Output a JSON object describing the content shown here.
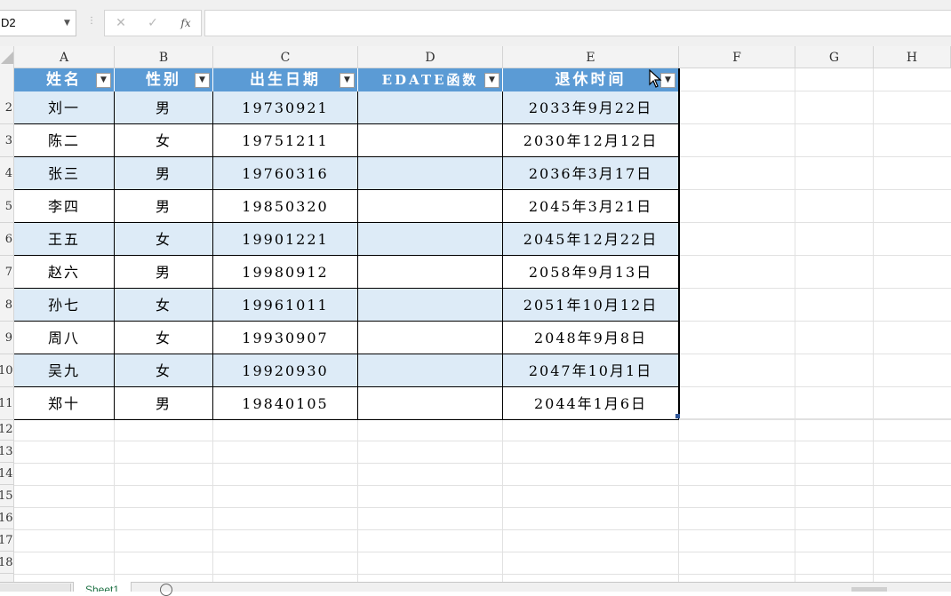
{
  "formula_bar": {
    "name_box": "D2",
    "cancel_icon": "✕",
    "confirm_icon": "✓",
    "fx_icon": "fx",
    "formula": ""
  },
  "columns": [
    "A",
    "B",
    "C",
    "D",
    "E",
    "F",
    "G",
    "H"
  ],
  "rows": [
    "2",
    "3",
    "4",
    "5",
    "6",
    "7",
    "8",
    "9",
    "10",
    "11",
    "12",
    "13",
    "14",
    "15",
    "16",
    "17",
    "18"
  ],
  "table": {
    "headers": [
      "姓名",
      "性别",
      "出生日期",
      "EDATE函数",
      "退休时间"
    ],
    "rows": [
      [
        "刘一",
        "男",
        "19730921",
        "",
        "2033年9月22日"
      ],
      [
        "陈二",
        "女",
        "19751211",
        "",
        "2030年12月12日"
      ],
      [
        "张三",
        "男",
        "19760316",
        "",
        "2036年3月17日"
      ],
      [
        "李四",
        "男",
        "19850320",
        "",
        "2045年3月21日"
      ],
      [
        "王五",
        "女",
        "19901221",
        "",
        "2045年12月22日"
      ],
      [
        "赵六",
        "男",
        "19980912",
        "",
        "2058年9月13日"
      ],
      [
        "孙七",
        "女",
        "19961011",
        "",
        "2051年10月12日"
      ],
      [
        "周八",
        "女",
        "19930907",
        "",
        "2048年9月8日"
      ],
      [
        "吴九",
        "女",
        "19920930",
        "",
        "2047年10月1日"
      ],
      [
        "郑十",
        "男",
        "19840105",
        "",
        "2044年1月6日"
      ]
    ]
  },
  "filter_icon": "▼",
  "sheet_tabs": [
    "Sheet1"
  ],
  "colors": {
    "header_fill": "#5b9bd5",
    "band_fill": "#ddebf7",
    "tab_text": "#217346"
  }
}
